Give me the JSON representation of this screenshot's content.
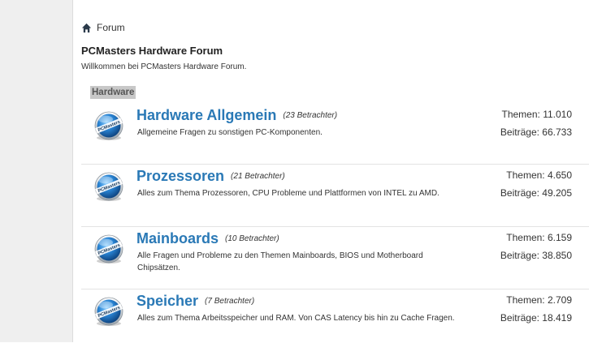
{
  "breadcrumb": {
    "home_label": "Forum"
  },
  "header": {
    "title": "PCMasters Hardware Forum",
    "description": "Willkommen bei PCMasters Hardware Forum."
  },
  "section": {
    "label": "Hardware"
  },
  "stat_labels": {
    "themes": "Themen:",
    "posts": "Beiträge:"
  },
  "forums": [
    {
      "title": "Hardware Allgemein",
      "viewers": "(23 Betrachter)",
      "description": "Allgemeine Fragen zu sonstigen PC-Komponenten.",
      "themes": "11.010",
      "posts": "66.733"
    },
    {
      "title": "Prozessoren",
      "viewers": "(21 Betrachter)",
      "description": "Alles zum Thema Prozessoren, CPU Probleme und Plattformen von INTEL zu AMD.",
      "themes": "4.650",
      "posts": "49.205"
    },
    {
      "title": "Mainboards",
      "viewers": "(10 Betrachter)",
      "description": "Alle Fragen und Probleme zu den Themen Mainboards, BIOS und Motherboard Chipsätzen.",
      "themes": "6.159",
      "posts": "38.850"
    },
    {
      "title": "Speicher",
      "viewers": "(7 Betrachter)",
      "description": "Alles zum Thema Arbeitsspeicher und RAM. Von CAS Latency bis hin zu Cache Fragen.",
      "themes": "2.709",
      "posts": "18.419"
    }
  ],
  "logo": {
    "text": "PCMasters"
  },
  "colors": {
    "link": "#2a79b6",
    "section_bg": "#c8c8c8"
  }
}
